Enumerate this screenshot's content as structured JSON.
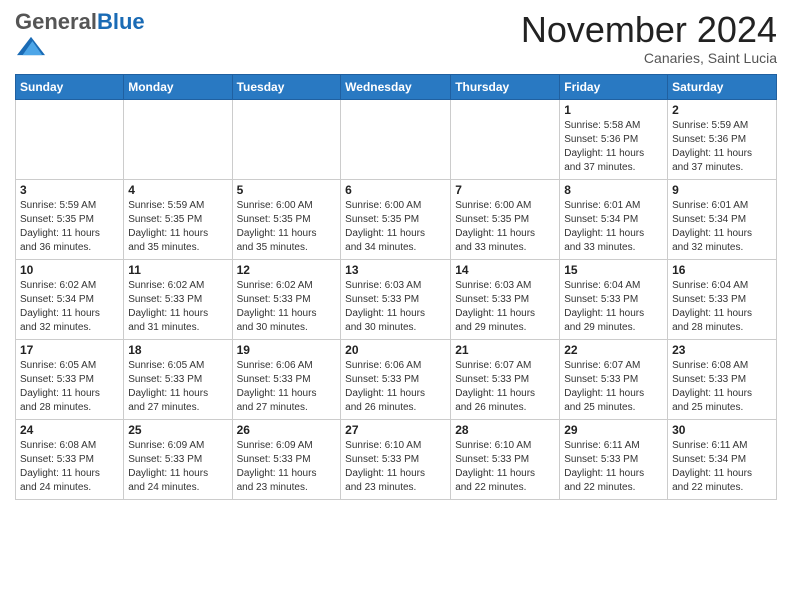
{
  "header": {
    "logo_general": "General",
    "logo_blue": "Blue",
    "month_title": "November 2024",
    "subtitle": "Canaries, Saint Lucia"
  },
  "weekdays": [
    "Sunday",
    "Monday",
    "Tuesday",
    "Wednesday",
    "Thursday",
    "Friday",
    "Saturday"
  ],
  "weeks": [
    [
      {
        "day": "",
        "info": ""
      },
      {
        "day": "",
        "info": ""
      },
      {
        "day": "",
        "info": ""
      },
      {
        "day": "",
        "info": ""
      },
      {
        "day": "",
        "info": ""
      },
      {
        "day": "1",
        "info": "Sunrise: 5:58 AM\nSunset: 5:36 PM\nDaylight: 11 hours\nand 37 minutes."
      },
      {
        "day": "2",
        "info": "Sunrise: 5:59 AM\nSunset: 5:36 PM\nDaylight: 11 hours\nand 37 minutes."
      }
    ],
    [
      {
        "day": "3",
        "info": "Sunrise: 5:59 AM\nSunset: 5:35 PM\nDaylight: 11 hours\nand 36 minutes."
      },
      {
        "day": "4",
        "info": "Sunrise: 5:59 AM\nSunset: 5:35 PM\nDaylight: 11 hours\nand 35 minutes."
      },
      {
        "day": "5",
        "info": "Sunrise: 6:00 AM\nSunset: 5:35 PM\nDaylight: 11 hours\nand 35 minutes."
      },
      {
        "day": "6",
        "info": "Sunrise: 6:00 AM\nSunset: 5:35 PM\nDaylight: 11 hours\nand 34 minutes."
      },
      {
        "day": "7",
        "info": "Sunrise: 6:00 AM\nSunset: 5:35 PM\nDaylight: 11 hours\nand 33 minutes."
      },
      {
        "day": "8",
        "info": "Sunrise: 6:01 AM\nSunset: 5:34 PM\nDaylight: 11 hours\nand 33 minutes."
      },
      {
        "day": "9",
        "info": "Sunrise: 6:01 AM\nSunset: 5:34 PM\nDaylight: 11 hours\nand 32 minutes."
      }
    ],
    [
      {
        "day": "10",
        "info": "Sunrise: 6:02 AM\nSunset: 5:34 PM\nDaylight: 11 hours\nand 32 minutes."
      },
      {
        "day": "11",
        "info": "Sunrise: 6:02 AM\nSunset: 5:33 PM\nDaylight: 11 hours\nand 31 minutes."
      },
      {
        "day": "12",
        "info": "Sunrise: 6:02 AM\nSunset: 5:33 PM\nDaylight: 11 hours\nand 30 minutes."
      },
      {
        "day": "13",
        "info": "Sunrise: 6:03 AM\nSunset: 5:33 PM\nDaylight: 11 hours\nand 30 minutes."
      },
      {
        "day": "14",
        "info": "Sunrise: 6:03 AM\nSunset: 5:33 PM\nDaylight: 11 hours\nand 29 minutes."
      },
      {
        "day": "15",
        "info": "Sunrise: 6:04 AM\nSunset: 5:33 PM\nDaylight: 11 hours\nand 29 minutes."
      },
      {
        "day": "16",
        "info": "Sunrise: 6:04 AM\nSunset: 5:33 PM\nDaylight: 11 hours\nand 28 minutes."
      }
    ],
    [
      {
        "day": "17",
        "info": "Sunrise: 6:05 AM\nSunset: 5:33 PM\nDaylight: 11 hours\nand 28 minutes."
      },
      {
        "day": "18",
        "info": "Sunrise: 6:05 AM\nSunset: 5:33 PM\nDaylight: 11 hours\nand 27 minutes."
      },
      {
        "day": "19",
        "info": "Sunrise: 6:06 AM\nSunset: 5:33 PM\nDaylight: 11 hours\nand 27 minutes."
      },
      {
        "day": "20",
        "info": "Sunrise: 6:06 AM\nSunset: 5:33 PM\nDaylight: 11 hours\nand 26 minutes."
      },
      {
        "day": "21",
        "info": "Sunrise: 6:07 AM\nSunset: 5:33 PM\nDaylight: 11 hours\nand 26 minutes."
      },
      {
        "day": "22",
        "info": "Sunrise: 6:07 AM\nSunset: 5:33 PM\nDaylight: 11 hours\nand 25 minutes."
      },
      {
        "day": "23",
        "info": "Sunrise: 6:08 AM\nSunset: 5:33 PM\nDaylight: 11 hours\nand 25 minutes."
      }
    ],
    [
      {
        "day": "24",
        "info": "Sunrise: 6:08 AM\nSunset: 5:33 PM\nDaylight: 11 hours\nand 24 minutes."
      },
      {
        "day": "25",
        "info": "Sunrise: 6:09 AM\nSunset: 5:33 PM\nDaylight: 11 hours\nand 24 minutes."
      },
      {
        "day": "26",
        "info": "Sunrise: 6:09 AM\nSunset: 5:33 PM\nDaylight: 11 hours\nand 23 minutes."
      },
      {
        "day": "27",
        "info": "Sunrise: 6:10 AM\nSunset: 5:33 PM\nDaylight: 11 hours\nand 23 minutes."
      },
      {
        "day": "28",
        "info": "Sunrise: 6:10 AM\nSunset: 5:33 PM\nDaylight: 11 hours\nand 22 minutes."
      },
      {
        "day": "29",
        "info": "Sunrise: 6:11 AM\nSunset: 5:33 PM\nDaylight: 11 hours\nand 22 minutes."
      },
      {
        "day": "30",
        "info": "Sunrise: 6:11 AM\nSunset: 5:34 PM\nDaylight: 11 hours\nand 22 minutes."
      }
    ]
  ]
}
